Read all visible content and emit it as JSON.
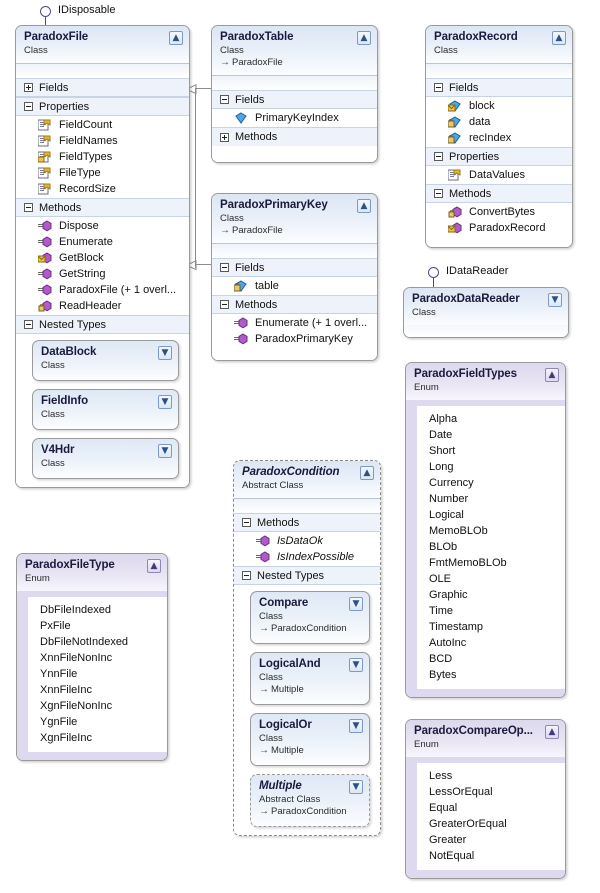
{
  "diagram": {
    "title": "Paradox class diagram",
    "colors": {
      "class_header_top": "#dce6f4",
      "enum_header_top": "#ddd9ee",
      "compartment_bg": "#eef2fa",
      "border": "#9a9a9a",
      "connector": "#8c8c8c"
    }
  },
  "interfaces": [
    {
      "name": "IDisposable",
      "icon": "interface-lollipop-icon"
    },
    {
      "name": "IDataReader",
      "icon": "interface-lollipop-icon"
    }
  ],
  "types": {
    "paradox_file": {
      "name": "ParadoxFile",
      "kind": "Class",
      "collapse_glyph": "«",
      "compartments": [
        {
          "label": "Fields",
          "state": "collapsed",
          "members": []
        },
        {
          "label": "Properties",
          "state": "expanded",
          "members": [
            {
              "name": "FieldCount",
              "icon": "property-icon"
            },
            {
              "name": "FieldNames",
              "icon": "property-icon"
            },
            {
              "name": "FieldTypes",
              "icon": "property-private-icon"
            },
            {
              "name": "FileType",
              "icon": "property-icon"
            },
            {
              "name": "RecordSize",
              "icon": "property-icon"
            }
          ]
        },
        {
          "label": "Methods",
          "state": "expanded",
          "members": [
            {
              "name": "Dispose",
              "icon": "method-icon"
            },
            {
              "name": "Enumerate",
              "icon": "method-icon"
            },
            {
              "name": "GetBlock",
              "icon": "method-internal-icon"
            },
            {
              "name": "GetString",
              "icon": "method-icon"
            },
            {
              "name": "ParadoxFile (+ 1 overl...",
              "icon": "method-icon"
            },
            {
              "name": "ReadHeader",
              "icon": "method-private-icon"
            }
          ]
        },
        {
          "label": "Nested Types",
          "state": "expanded",
          "members": []
        }
      ],
      "nested_types": [
        {
          "name": "DataBlock",
          "kind": "Class",
          "base": ""
        },
        {
          "name": "FieldInfo",
          "kind": "Class",
          "base": ""
        },
        {
          "name": "V4Hdr",
          "kind": "Class",
          "base": ""
        }
      ]
    },
    "paradox_table": {
      "name": "ParadoxTable",
      "kind": "Class",
      "base": "ParadoxFile",
      "compartments": [
        {
          "label": "Fields",
          "state": "expanded",
          "members": [
            {
              "name": "PrimaryKeyIndex",
              "icon": "field-icon"
            }
          ]
        },
        {
          "label": "Methods",
          "state": "collapsed",
          "members": []
        }
      ]
    },
    "paradox_primary_key": {
      "name": "ParadoxPrimaryKey",
      "kind": "Class",
      "base": "ParadoxFile",
      "compartments": [
        {
          "label": "Fields",
          "state": "expanded",
          "members": [
            {
              "name": "table",
              "icon": "field-private-icon"
            }
          ]
        },
        {
          "label": "Methods",
          "state": "expanded",
          "members": [
            {
              "name": "Enumerate (+ 1 overl...",
              "icon": "method-icon"
            },
            {
              "name": "ParadoxPrimaryKey",
              "icon": "method-icon"
            }
          ]
        }
      ]
    },
    "paradox_record": {
      "name": "ParadoxRecord",
      "kind": "Class",
      "compartments": [
        {
          "label": "Fields",
          "state": "expanded",
          "members": [
            {
              "name": "block",
              "icon": "field-internal-icon"
            },
            {
              "name": "data",
              "icon": "field-private-icon"
            },
            {
              "name": "recIndex",
              "icon": "field-private-icon"
            }
          ]
        },
        {
          "label": "Properties",
          "state": "expanded",
          "members": [
            {
              "name": "DataValues",
              "icon": "property-icon"
            }
          ]
        },
        {
          "label": "Methods",
          "state": "expanded",
          "members": [
            {
              "name": "ConvertBytes",
              "icon": "method-private-icon"
            },
            {
              "name": "ParadoxRecord",
              "icon": "method-internal-icon"
            }
          ]
        }
      ]
    },
    "paradox_data_reader": {
      "name": "ParadoxDataReader",
      "kind": "Class",
      "collapsed": true
    },
    "paradox_condition": {
      "name": "ParadoxCondition",
      "kind": "Abstract Class",
      "abstract": true,
      "compartments": [
        {
          "label": "Methods",
          "state": "expanded",
          "members": [
            {
              "name": "IsDataOk",
              "icon": "method-icon",
              "italic": true
            },
            {
              "name": "IsIndexPossible",
              "icon": "method-icon",
              "italic": true
            }
          ]
        },
        {
          "label": "Nested Types",
          "state": "expanded",
          "members": []
        }
      ],
      "nested_types": [
        {
          "name": "Compare",
          "kind": "Class",
          "base": "ParadoxCondition",
          "abstract": false
        },
        {
          "name": "LogicalAnd",
          "kind": "Class",
          "base": "Multiple",
          "abstract": false
        },
        {
          "name": "LogicalOr",
          "kind": "Class",
          "base": "Multiple",
          "abstract": false
        },
        {
          "name": "Multiple",
          "kind": "Abstract Class",
          "base": "ParadoxCondition",
          "abstract": true
        }
      ]
    },
    "paradox_file_type": {
      "name": "ParadoxFileType",
      "kind": "Enum",
      "values": [
        "DbFileIndexed",
        "PxFile",
        "DbFileNotIndexed",
        "XnnFileNonInc",
        "YnnFile",
        "XnnFileInc",
        "XgnFileNonInc",
        "YgnFile",
        "XgnFileInc"
      ]
    },
    "paradox_field_types": {
      "name": "ParadoxFieldTypes",
      "kind": "Enum",
      "values": [
        "Alpha",
        "Date",
        "Short",
        "Long",
        "Currency",
        "Number",
        "Logical",
        "MemoBLOb",
        "BLOb",
        "FmtMemoBLOb",
        "OLE",
        "Graphic",
        "Time",
        "Timestamp",
        "AutoInc",
        "BCD",
        "Bytes"
      ]
    },
    "paradox_compare_op": {
      "name": "ParadoxCompareOp...",
      "kind": "Enum",
      "values": [
        "Less",
        "LessOrEqual",
        "Equal",
        "GreaterOrEqual",
        "Greater",
        "NotEqual"
      ]
    }
  },
  "relations": [
    {
      "from": "ParadoxTable",
      "to": "ParadoxFile",
      "type": "inheritance"
    },
    {
      "from": "ParadoxPrimaryKey",
      "to": "ParadoxFile",
      "type": "inheritance"
    },
    {
      "from": "ParadoxFile",
      "to": "IDisposable",
      "type": "realization"
    },
    {
      "from": "ParadoxDataReader",
      "to": "IDataReader",
      "type": "realization"
    }
  ]
}
